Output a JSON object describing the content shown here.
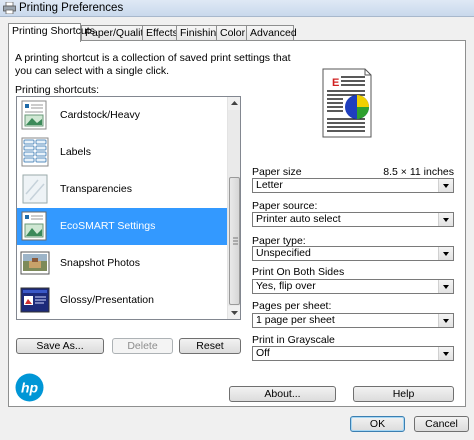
{
  "window": {
    "title": "Printing Preferences"
  },
  "tabs": [
    {
      "label": "Printing Shortcuts"
    },
    {
      "label": "Paper/Quality"
    },
    {
      "label": "Effects"
    },
    {
      "label": "Finishing"
    },
    {
      "label": "Color"
    },
    {
      "label": "Advanced"
    }
  ],
  "description": "A printing shortcut is a collection of saved print settings that you can select with a single click.",
  "shortcuts": {
    "label": "Printing shortcuts:",
    "items": [
      {
        "label": "Cardstock/Heavy",
        "icon": "cardstock-doc-icon"
      },
      {
        "label": "Labels",
        "icon": "labels-sheet-icon"
      },
      {
        "label": "Transparencies",
        "icon": "transparency-icon"
      },
      {
        "label": "EcoSMART Settings",
        "icon": "ecosmart-doc-icon"
      },
      {
        "label": "Snapshot Photos",
        "icon": "photo-icon"
      },
      {
        "label": "Glossy/Presentation",
        "icon": "presentation-slide-icon"
      }
    ],
    "selected": "EcoSMART Settings"
  },
  "buttons": {
    "save_as": "Save As...",
    "delete": "Delete",
    "reset": "Reset",
    "about": "About...",
    "help": "Help",
    "ok": "OK",
    "cancel": "Cancel"
  },
  "settings": {
    "paper_size": {
      "label": "Paper size",
      "dimension": "8.5 × 11 inches",
      "value": "Letter"
    },
    "paper_source": {
      "label": "Paper source:",
      "value": "Printer auto select"
    },
    "paper_type": {
      "label": "Paper type:",
      "value": "Unspecified"
    },
    "print_both_sides": {
      "label": "Print On Both Sides",
      "value": "Yes, flip over"
    },
    "pages_per_sheet": {
      "label": "Pages per sheet:",
      "value": "1 page per sheet"
    },
    "grayscale": {
      "label": "Print in Grayscale",
      "value": "Off"
    }
  },
  "preview_glyph": "E",
  "colors": {
    "selection": "#3399ff",
    "hp_blue": "#0096d6"
  }
}
